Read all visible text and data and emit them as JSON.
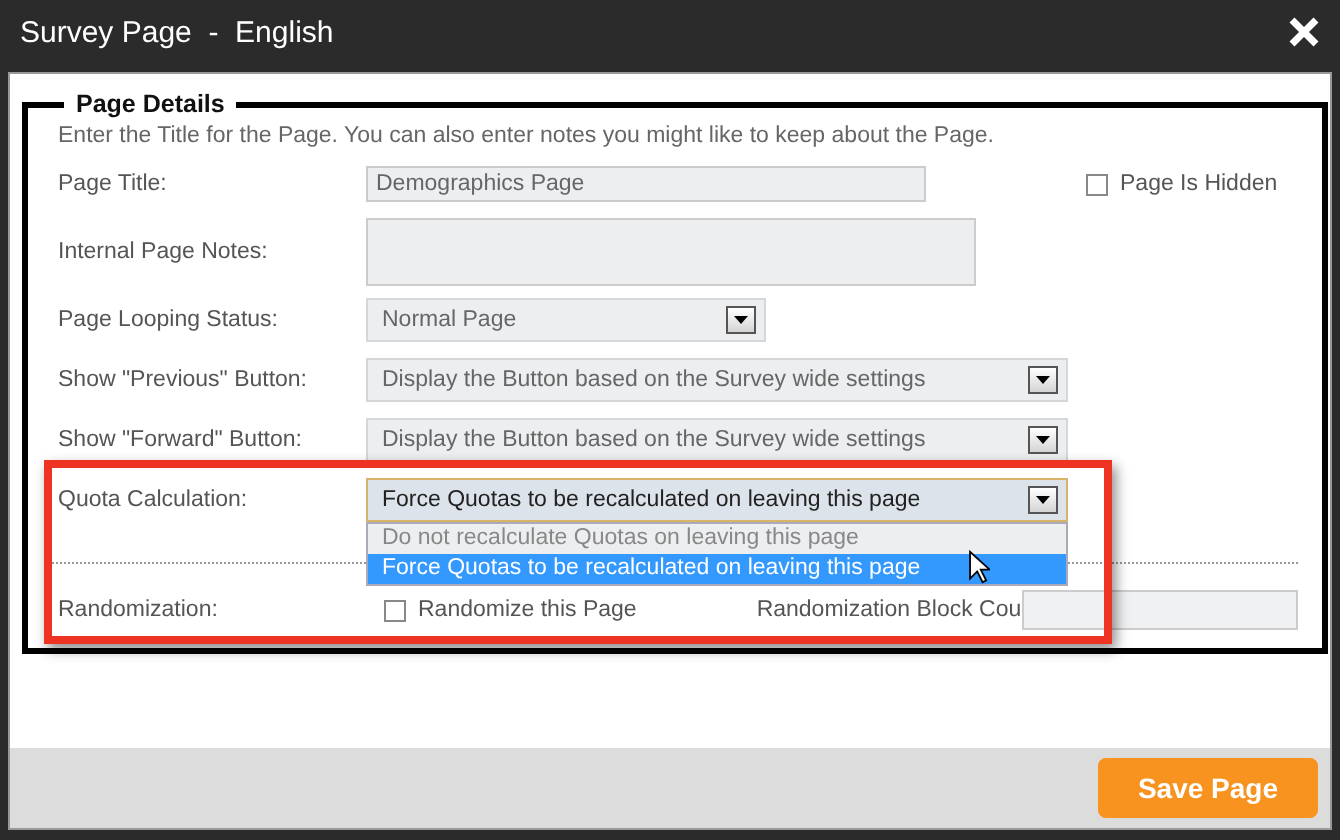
{
  "window": {
    "title": "Survey Page  -  English"
  },
  "section": {
    "legend": "Page Details",
    "description": "Enter the Title for the Page. You can also enter notes you might like to keep about the Page.",
    "fields": [
      {
        "kind": "text",
        "label": "Page Title:",
        "value": "Demographics Page"
      },
      {
        "kind": "textarea",
        "label": "Internal Page Notes:"
      },
      {
        "kind": "select",
        "label": "Page Looping Status:",
        "value": "Normal Page",
        "highlighted": false,
        "expanded": false
      },
      {
        "kind": "select",
        "label": "Show \"Previous\" Button:",
        "value": "Display the Button based on the Survey wide settings",
        "highlighted": false,
        "expanded": false
      },
      {
        "kind": "select",
        "label": "Show \"Forward\" Button:",
        "value": "Display the Button based on the Survey wide settings",
        "highlighted": false,
        "expanded": false
      },
      {
        "kind": "select",
        "label": "Quota Calculation:",
        "value": "Force Quotas to be recalculated on leaving this page",
        "highlighted": true,
        "expanded": true,
        "options": [
          {
            "label": "Do not recalculate Quotas on leaving this page",
            "selected": false
          },
          {
            "label": "Force Quotas to be recalculated on leaving this page",
            "selected": true
          }
        ]
      }
    ],
    "page_hidden": {
      "label": "Page Is Hidden",
      "checked": false
    },
    "randomization": {
      "label": "Randomization:",
      "checkbox": {
        "label": "Randomize this Page",
        "checked": false
      },
      "block_count_label": "Randomization Block Cou"
    }
  },
  "footer": {
    "save_button": "Save Page"
  }
}
